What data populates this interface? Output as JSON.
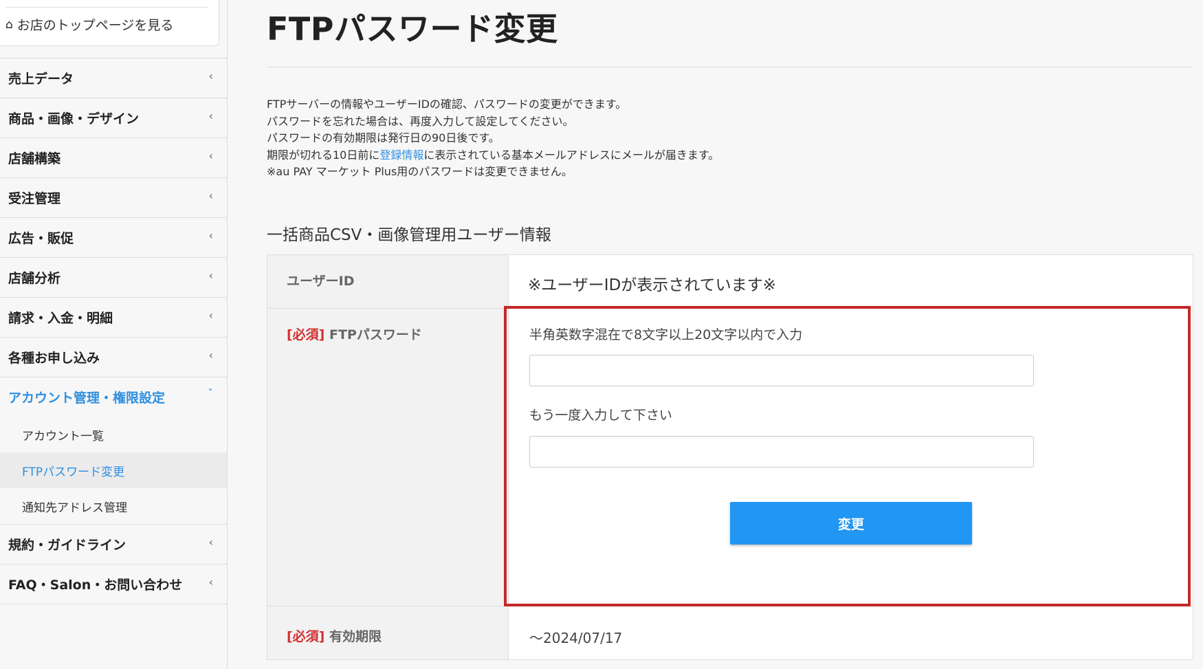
{
  "sidebar": {
    "store_link": "お店のトップページを見る",
    "nav": [
      {
        "label": "売上データ"
      },
      {
        "label": "商品・画像・デザイン"
      },
      {
        "label": "店舗構築"
      },
      {
        "label": "受注管理"
      },
      {
        "label": "広告・販促"
      },
      {
        "label": "店舗分析"
      },
      {
        "label": "請求・入金・明細"
      },
      {
        "label": "各種お申し込み"
      },
      {
        "label": "アカウント管理・権限設定"
      }
    ],
    "sub_items": [
      {
        "label": "アカウント一覧"
      },
      {
        "label": "FTPパスワード変更"
      },
      {
        "label": "通知先アドレス管理"
      }
    ],
    "nav_after": [
      {
        "label": "規約・ガイドライン"
      },
      {
        "label": "FAQ・Salon・お問い合わせ"
      }
    ]
  },
  "main": {
    "title": "FTPパスワード変更",
    "description": {
      "line1": "FTPサーバーの情報やユーザーIDの確認、パスワードの変更ができます。",
      "line2": "パスワードを忘れた場合は、再度入力して設定してください。",
      "line3": "パスワードの有効期限は発行日の90日後です。",
      "line4_pre": "期限が切れる10日前に",
      "line4_link": "登録情報",
      "line4_post": "に表示されている基本メールアドレスにメールが届きます。",
      "line5": "※au PAY マーケット Plus用のパスワードは変更できません。"
    },
    "section_title": "一括商品CSV・画像管理用ユーザー情報",
    "table": {
      "userid_label": "ユーザーID",
      "userid_value": "※ユーザーIDが表示されています※",
      "required_tag": "[必須]",
      "password_label": "FTPパスワード",
      "password_hint": "半角英数字混在で8文字以上20文字以内で入力",
      "confirm_hint": "もう一度入力して下さい",
      "submit_label": "変更",
      "expiry_label": "有効期限",
      "expiry_value": "～2024/07/17"
    }
  },
  "colors": {
    "accent": "#2f8fe0",
    "button": "#2196f3",
    "required": "#d32f2f",
    "highlight": "#c62828"
  }
}
